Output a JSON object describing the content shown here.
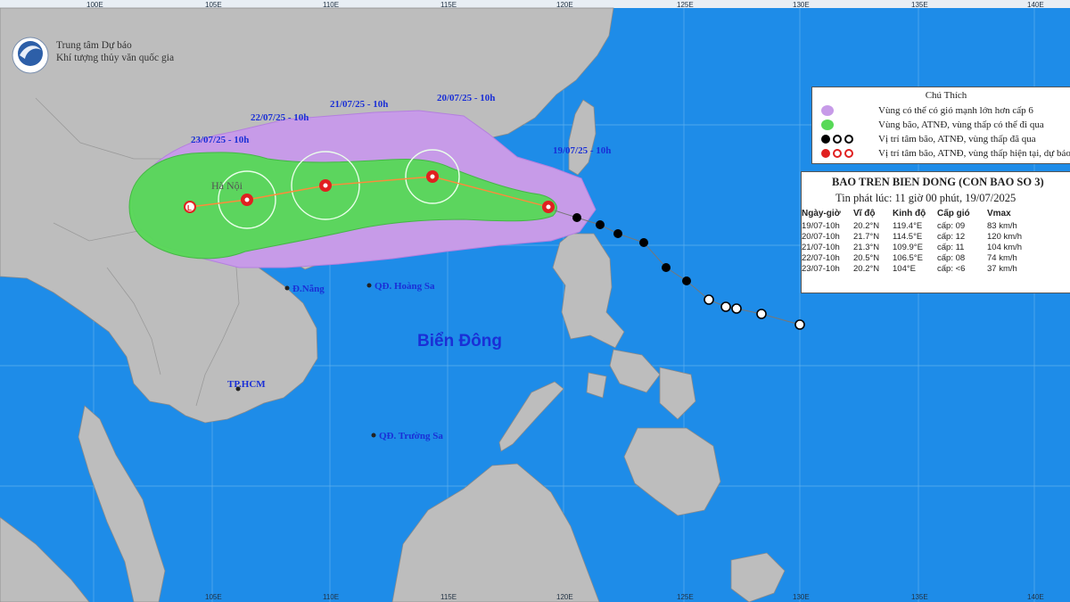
{
  "agency": {
    "line1": "Trung tâm Dự báo",
    "line2": "Khí tượng thủy văn quốc gia"
  },
  "longitude_labels_top": [
    "100E",
    "105E",
    "110E",
    "115E",
    "120E",
    "125E",
    "130E",
    "135E",
    "140E"
  ],
  "longitude_labels_bottom": [
    "105E",
    "110E",
    "115E",
    "120E",
    "125E",
    "130E",
    "135E",
    "140E"
  ],
  "places": {
    "hanoi": "Hà Nội",
    "danang": "Đ.Nẵng",
    "hoangsa": "QĐ. Hoàng Sa",
    "hcm": "TP.HCM",
    "truongsa": "QĐ. Trường Sa",
    "biendong": "Biển Đông"
  },
  "forecast_labels": [
    "19/07/25 - 10h",
    "20/07/25 - 10h",
    "21/07/25 - 10h",
    "22/07/25 - 10h",
    "23/07/25 - 10h"
  ],
  "legend": {
    "title": "Chú Thích",
    "items": [
      {
        "text": "Vùng có thể có gió mạnh lớn hơn cấp 6",
        "color": "#c79be8"
      },
      {
        "text": "Vùng bão, ATNĐ, vùng thấp có thể đi qua",
        "color": "#57d957"
      },
      {
        "text": "Vị trí tâm bão, ATNĐ, vùng thấp đã qua",
        "color": "#000000"
      },
      {
        "text": "Vị trí tâm bão, ATNĐ, vùng thấp hiện tại, dự báo",
        "color": "#e02020"
      }
    ]
  },
  "bulletin": {
    "title": "BAO TREN BIEN DONG (CON BAO SO 3)",
    "issued": "Tin phát lúc: 11 giờ 00 phút, 19/07/2025",
    "columns": [
      "Ngày-giờ",
      "Vĩ độ",
      "Kinh độ",
      "Cấp gió",
      "Vmax"
    ],
    "rows": [
      [
        "19/07-10h",
        "20.2°N",
        "119.4°E",
        "cấp: 09",
        "83 km/h"
      ],
      [
        "20/07-10h",
        "21.7°N",
        "114.5°E",
        "cấp: 12",
        "120 km/h"
      ],
      [
        "21/07-10h",
        "21.3°N",
        "109.9°E",
        "cấp: 11",
        "104 km/h"
      ],
      [
        "22/07-10h",
        "20.5°N",
        "106.5°E",
        "cấp: 08",
        "74 km/h"
      ],
      [
        "23/07-10h",
        "20.2°N",
        "104°E",
        "cấp: <6",
        "37 km/h"
      ]
    ]
  },
  "colors": {
    "sea": "#1e8ce8",
    "land": "#bdbdbd",
    "strong_wind_zone": "#c79be8",
    "storm_zone": "#57d957",
    "track": "#ff8a3a",
    "label_blue": "#1a2fd6"
  }
}
